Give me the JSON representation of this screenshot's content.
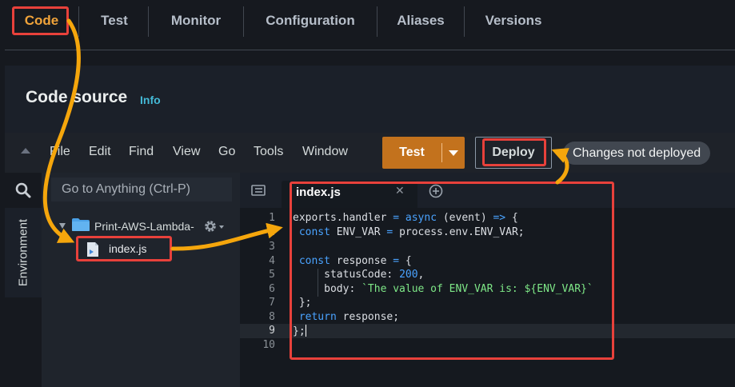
{
  "tabs": [
    {
      "label": "Code",
      "active": true
    },
    {
      "label": "Test"
    },
    {
      "label": "Monitor"
    },
    {
      "label": "Configuration"
    },
    {
      "label": "Aliases"
    },
    {
      "label": "Versions"
    }
  ],
  "code_source": {
    "title": "Code source",
    "info_link": "Info"
  },
  "menu": {
    "items": [
      "File",
      "Edit",
      "Find",
      "View",
      "Go",
      "Tools",
      "Window"
    ],
    "test_button": "Test",
    "deploy_button": "Deploy",
    "status_badge": "Changes not deployed"
  },
  "sidebar": {
    "environment_label": "Environment",
    "goto_placeholder": "Go to Anything (Ctrl-P)",
    "folder_name": "Print-AWS-Lambda-",
    "file_name": "index.js"
  },
  "editor": {
    "tab_label": "index.js",
    "line_numbers": [
      "1",
      "2",
      "3",
      "4",
      "5",
      "6",
      "7",
      "8",
      "9",
      "10"
    ],
    "code_lines": [
      "exports.handler = async (event) => {",
      " const ENV_VAR = process.env.ENV_VAR;",
      "",
      " const response = {",
      "     statusCode: 200,",
      "     body: `The value of ENV_VAR is: ${ENV_VAR}`",
      " };",
      " return response;",
      "};",
      ""
    ]
  },
  "colors": {
    "annotation_red": "#e8413b",
    "arrow_orange": "#f5a60c",
    "test_button_bg": "#c3721d",
    "info_link": "#44b9d6"
  },
  "icons": [
    "search-icon",
    "folder-icon",
    "gear-icon",
    "javascript-file-icon",
    "list-icon",
    "close-icon",
    "add-tab-icon"
  ]
}
